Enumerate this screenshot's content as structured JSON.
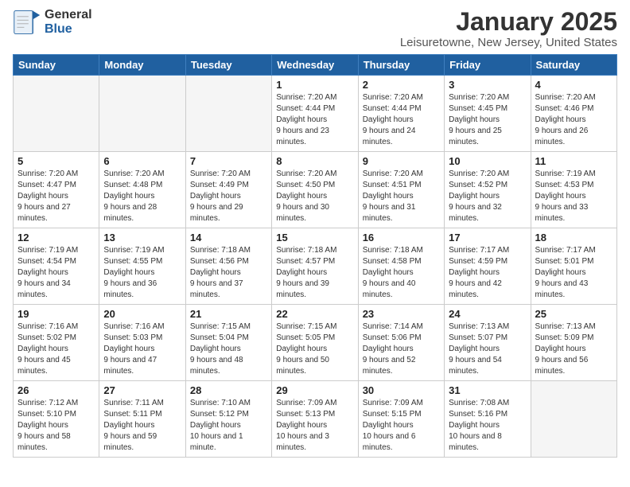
{
  "header": {
    "logo_general": "General",
    "logo_blue": "Blue",
    "month": "January 2025",
    "location": "Leisuretowne, New Jersey, United States"
  },
  "weekdays": [
    "Sunday",
    "Monday",
    "Tuesday",
    "Wednesday",
    "Thursday",
    "Friday",
    "Saturday"
  ],
  "weeks": [
    [
      {
        "day": "",
        "empty": true
      },
      {
        "day": "",
        "empty": true
      },
      {
        "day": "",
        "empty": true
      },
      {
        "day": "1",
        "sunrise": "7:20 AM",
        "sunset": "4:44 PM",
        "daylight": "9 hours and 23 minutes."
      },
      {
        "day": "2",
        "sunrise": "7:20 AM",
        "sunset": "4:44 PM",
        "daylight": "9 hours and 24 minutes."
      },
      {
        "day": "3",
        "sunrise": "7:20 AM",
        "sunset": "4:45 PM",
        "daylight": "9 hours and 25 minutes."
      },
      {
        "day": "4",
        "sunrise": "7:20 AM",
        "sunset": "4:46 PM",
        "daylight": "9 hours and 26 minutes."
      }
    ],
    [
      {
        "day": "5",
        "sunrise": "7:20 AM",
        "sunset": "4:47 PM",
        "daylight": "9 hours and 27 minutes."
      },
      {
        "day": "6",
        "sunrise": "7:20 AM",
        "sunset": "4:48 PM",
        "daylight": "9 hours and 28 minutes."
      },
      {
        "day": "7",
        "sunrise": "7:20 AM",
        "sunset": "4:49 PM",
        "daylight": "9 hours and 29 minutes."
      },
      {
        "day": "8",
        "sunrise": "7:20 AM",
        "sunset": "4:50 PM",
        "daylight": "9 hours and 30 minutes."
      },
      {
        "day": "9",
        "sunrise": "7:20 AM",
        "sunset": "4:51 PM",
        "daylight": "9 hours and 31 minutes."
      },
      {
        "day": "10",
        "sunrise": "7:20 AM",
        "sunset": "4:52 PM",
        "daylight": "9 hours and 32 minutes."
      },
      {
        "day": "11",
        "sunrise": "7:19 AM",
        "sunset": "4:53 PM",
        "daylight": "9 hours and 33 minutes."
      }
    ],
    [
      {
        "day": "12",
        "sunrise": "7:19 AM",
        "sunset": "4:54 PM",
        "daylight": "9 hours and 34 minutes."
      },
      {
        "day": "13",
        "sunrise": "7:19 AM",
        "sunset": "4:55 PM",
        "daylight": "9 hours and 36 minutes."
      },
      {
        "day": "14",
        "sunrise": "7:18 AM",
        "sunset": "4:56 PM",
        "daylight": "9 hours and 37 minutes."
      },
      {
        "day": "15",
        "sunrise": "7:18 AM",
        "sunset": "4:57 PM",
        "daylight": "9 hours and 39 minutes."
      },
      {
        "day": "16",
        "sunrise": "7:18 AM",
        "sunset": "4:58 PM",
        "daylight": "9 hours and 40 minutes."
      },
      {
        "day": "17",
        "sunrise": "7:17 AM",
        "sunset": "4:59 PM",
        "daylight": "9 hours and 42 minutes."
      },
      {
        "day": "18",
        "sunrise": "7:17 AM",
        "sunset": "5:01 PM",
        "daylight": "9 hours and 43 minutes."
      }
    ],
    [
      {
        "day": "19",
        "sunrise": "7:16 AM",
        "sunset": "5:02 PM",
        "daylight": "9 hours and 45 minutes."
      },
      {
        "day": "20",
        "sunrise": "7:16 AM",
        "sunset": "5:03 PM",
        "daylight": "9 hours and 47 minutes."
      },
      {
        "day": "21",
        "sunrise": "7:15 AM",
        "sunset": "5:04 PM",
        "daylight": "9 hours and 48 minutes."
      },
      {
        "day": "22",
        "sunrise": "7:15 AM",
        "sunset": "5:05 PM",
        "daylight": "9 hours and 50 minutes."
      },
      {
        "day": "23",
        "sunrise": "7:14 AM",
        "sunset": "5:06 PM",
        "daylight": "9 hours and 52 minutes."
      },
      {
        "day": "24",
        "sunrise": "7:13 AM",
        "sunset": "5:07 PM",
        "daylight": "9 hours and 54 minutes."
      },
      {
        "day": "25",
        "sunrise": "7:13 AM",
        "sunset": "5:09 PM",
        "daylight": "9 hours and 56 minutes."
      }
    ],
    [
      {
        "day": "26",
        "sunrise": "7:12 AM",
        "sunset": "5:10 PM",
        "daylight": "9 hours and 58 minutes."
      },
      {
        "day": "27",
        "sunrise": "7:11 AM",
        "sunset": "5:11 PM",
        "daylight": "9 hours and 59 minutes."
      },
      {
        "day": "28",
        "sunrise": "7:10 AM",
        "sunset": "5:12 PM",
        "daylight": "10 hours and 1 minute."
      },
      {
        "day": "29",
        "sunrise": "7:09 AM",
        "sunset": "5:13 PM",
        "daylight": "10 hours and 3 minutes."
      },
      {
        "day": "30",
        "sunrise": "7:09 AM",
        "sunset": "5:15 PM",
        "daylight": "10 hours and 6 minutes."
      },
      {
        "day": "31",
        "sunrise": "7:08 AM",
        "sunset": "5:16 PM",
        "daylight": "10 hours and 8 minutes."
      },
      {
        "day": "",
        "empty": true
      }
    ]
  ]
}
